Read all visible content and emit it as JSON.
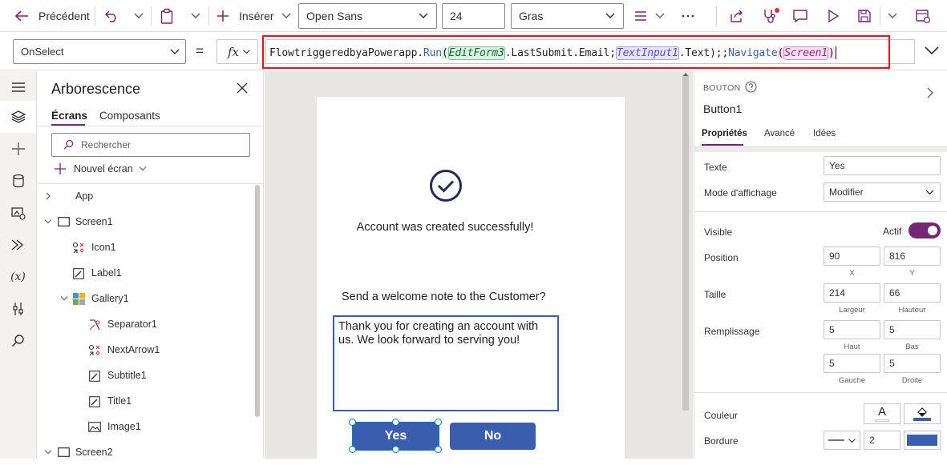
{
  "toolbar": {
    "back_label": "Précédent",
    "insert_label": "Insérer",
    "font_family": "Open Sans",
    "font_size": "24",
    "font_weight": "Gras"
  },
  "formula": {
    "property": "OnSelect",
    "equals": "=",
    "fx": "fx",
    "tokens": [
      {
        "text": "FlowtriggeredbyaPowerapp.",
        "kind": "plain"
      },
      {
        "text": "Run",
        "kind": "func"
      },
      {
        "text": "(",
        "kind": "paren-green"
      },
      {
        "text": "EditForm3",
        "kind": "ctrl-green"
      },
      {
        "text": ".LastSubmit.Email;",
        "kind": "plain"
      },
      {
        "text": "TextInput1",
        "kind": "ctrl-blue"
      },
      {
        "text": ".Text",
        "kind": "plain"
      },
      {
        "text": ");;",
        "kind": "plain"
      },
      {
        "text": "Navigate",
        "kind": "func"
      },
      {
        "text": "(",
        "kind": "paren-pink"
      },
      {
        "text": "Screen1",
        "kind": "ctrl-pink"
      },
      {
        "text": ")",
        "kind": "paren-pink"
      }
    ]
  },
  "tree": {
    "title": "Arborescence",
    "tabs": [
      "Écrans",
      "Composants"
    ],
    "search_placeholder": "Rechercher",
    "new_screen": "Nouvel écran",
    "items": [
      {
        "label": "App",
        "icon": "app-icon"
      },
      {
        "label": "Screen1",
        "icon": "screen-icon"
      },
      {
        "label": "Icon1",
        "icon": "icon-control-icon"
      },
      {
        "label": "Label1",
        "icon": "label-icon"
      },
      {
        "label": "Gallery1",
        "icon": "gallery-icon"
      },
      {
        "label": "Separator1",
        "icon": "separator-icon"
      },
      {
        "label": "NextArrow1",
        "icon": "icon-control-icon"
      },
      {
        "label": "Subtitle1",
        "icon": "label-icon"
      },
      {
        "label": "Title1",
        "icon": "label-icon"
      },
      {
        "label": "Image1",
        "icon": "image-icon"
      },
      {
        "label": "Screen2",
        "icon": "screen-icon"
      }
    ]
  },
  "screen": {
    "success_text": "Account was created successfully!",
    "question": "Send a welcome note to the Customer?",
    "note": "Thank you for creating an account with us. We look forward to serving you!",
    "yes_label": "Yes",
    "no_label": "No"
  },
  "props": {
    "type": "BOUTON",
    "name": "Button1",
    "tabs": [
      "Propriétés",
      "Avancé",
      "Idées"
    ],
    "text_label": "Texte",
    "text_value": "Yes",
    "display_label": "Mode d'affichage",
    "display_value": "Modifier",
    "visible_label": "Visible",
    "visible_state": "Actif",
    "position_label": "Position",
    "x": "90",
    "y": "816",
    "x_label": "X",
    "y_label": "Y",
    "size_label": "Taille",
    "width": "214",
    "height": "66",
    "width_label": "Largeur",
    "height_label": "Hauteur",
    "padding_label": "Remplissage",
    "pad_top": "5",
    "pad_bottom": "5",
    "pad_left": "5",
    "pad_right": "5",
    "pad_top_label": "Haut",
    "pad_bottom_label": "Bas",
    "pad_left_label": "Gauche",
    "pad_right_label": "Droite",
    "color_label": "Couleur",
    "color_glyph": "A",
    "border_label": "Bordure",
    "border_width": "2"
  },
  "colors": {
    "accent": "#742774",
    "button_blue": "#3a5ead",
    "check_navy": "#1f2d5c",
    "highlight_red": "#e81123"
  }
}
